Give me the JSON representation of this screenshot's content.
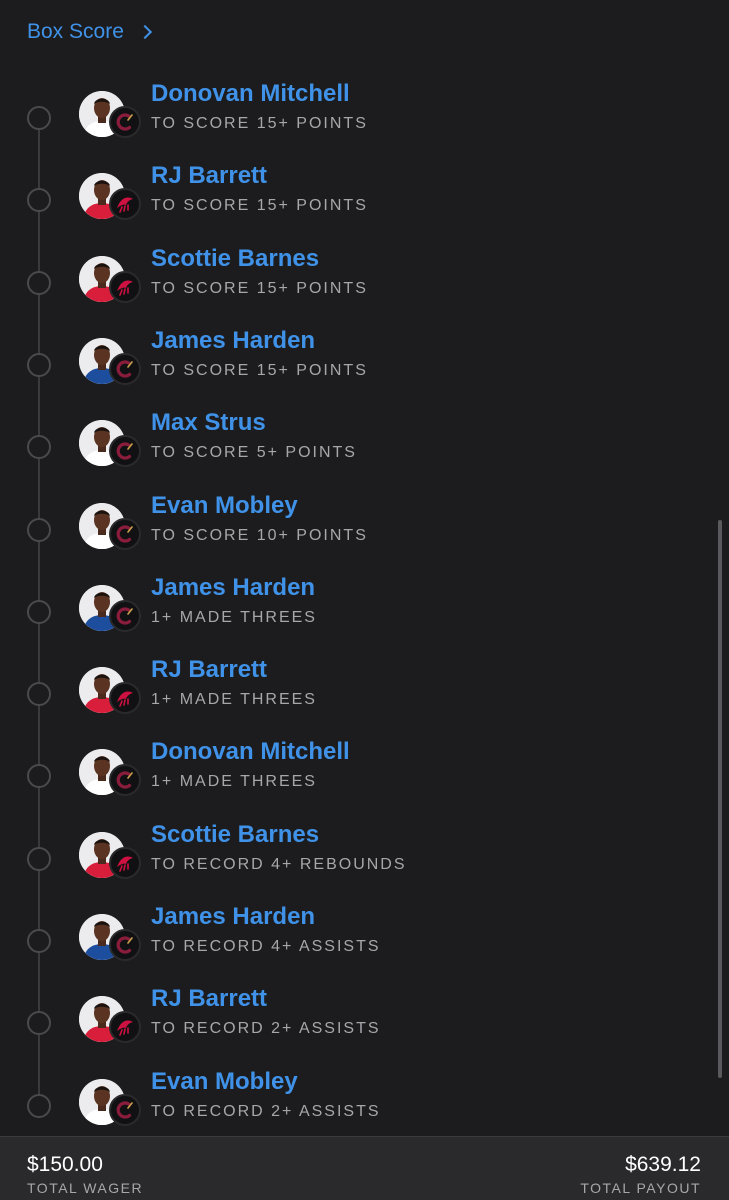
{
  "header": {
    "box_score_label": "Box Score"
  },
  "colors": {
    "accent": "#3f92e8",
    "background": "#1c1c1e",
    "cavaliers_wine": "#860038",
    "raptors_red": "#ce1141"
  },
  "legs": [
    {
      "player": "Donovan Mitchell",
      "market": "TO SCORE 15+ POINTS",
      "team": "Cavaliers",
      "jersey": "cavaliers"
    },
    {
      "player": "RJ Barrett",
      "market": "TO SCORE 15+ POINTS",
      "team": "Raptors",
      "jersey": "raptors"
    },
    {
      "player": "Scottie Barnes",
      "market": "TO SCORE 15+ POINTS",
      "team": "Raptors",
      "jersey": "raptors"
    },
    {
      "player": "James Harden",
      "market": "TO SCORE 15+ POINTS",
      "team": "Cavaliers",
      "jersey": "blue"
    },
    {
      "player": "Max Strus",
      "market": "TO SCORE 5+ POINTS",
      "team": "Cavaliers",
      "jersey": "cavaliers"
    },
    {
      "player": "Evan Mobley",
      "market": "TO SCORE 10+ POINTS",
      "team": "Cavaliers",
      "jersey": "cavaliers"
    },
    {
      "player": "James Harden",
      "market": "1+ MADE THREES",
      "team": "Cavaliers",
      "jersey": "blue"
    },
    {
      "player": "RJ Barrett",
      "market": "1+ MADE THREES",
      "team": "Raptors",
      "jersey": "raptors"
    },
    {
      "player": "Donovan Mitchell",
      "market": "1+ MADE THREES",
      "team": "Cavaliers",
      "jersey": "cavaliers"
    },
    {
      "player": "Scottie Barnes",
      "market": "TO RECORD 4+ REBOUNDS",
      "team": "Raptors",
      "jersey": "raptors"
    },
    {
      "player": "James Harden",
      "market": "TO RECORD 4+ ASSISTS",
      "team": "Cavaliers",
      "jersey": "blue"
    },
    {
      "player": "RJ Barrett",
      "market": "TO RECORD 2+ ASSISTS",
      "team": "Raptors",
      "jersey": "raptors"
    },
    {
      "player": "Evan Mobley",
      "market": "TO RECORD 2+ ASSISTS",
      "team": "Cavaliers",
      "jersey": "cavaliers"
    }
  ],
  "footer": {
    "total_wager": "$150.00",
    "total_wager_label": "TOTAL WAGER",
    "total_payout": "$639.12",
    "total_payout_label": "TOTAL PAYOUT"
  }
}
